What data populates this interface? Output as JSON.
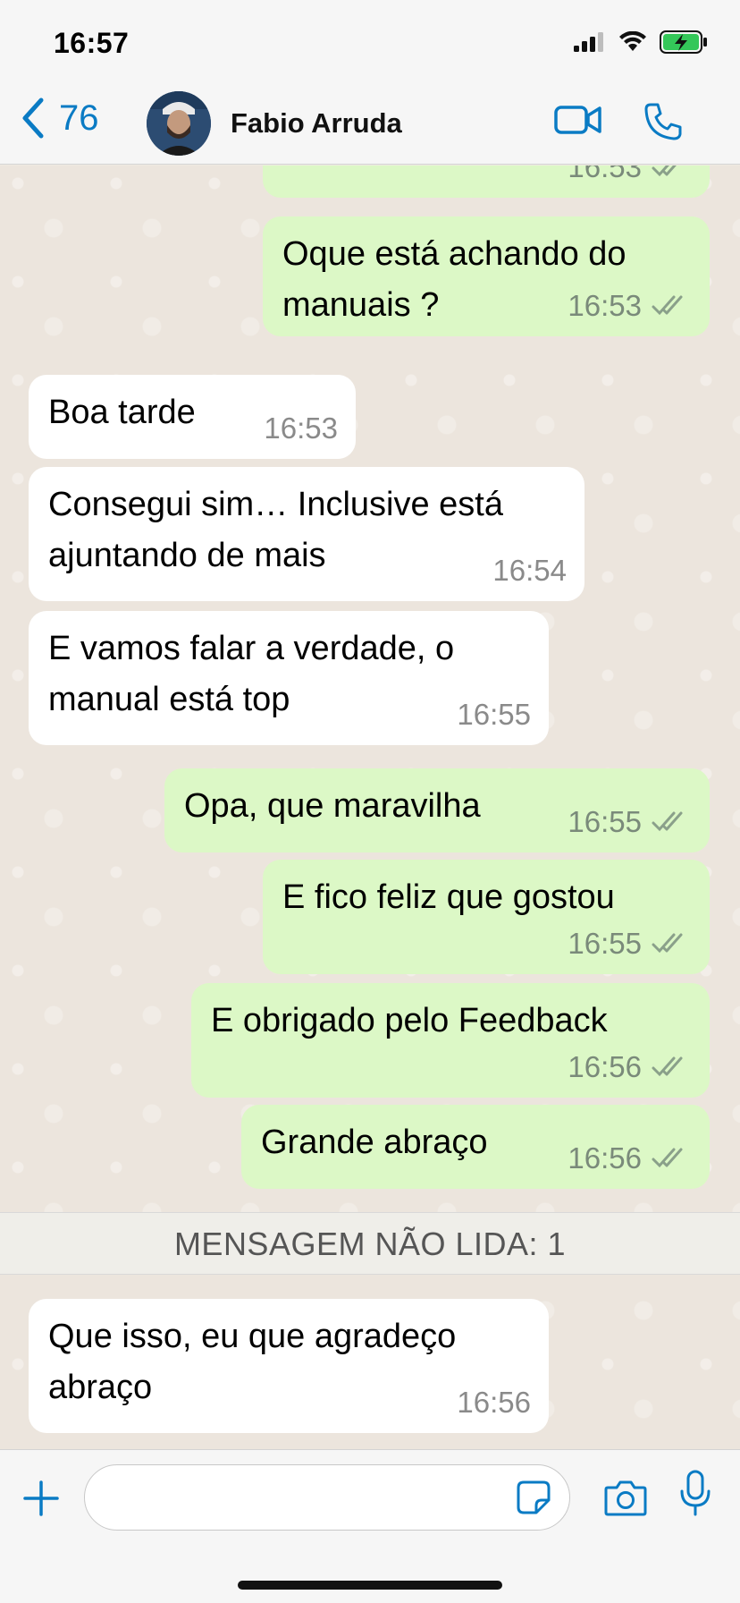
{
  "status_bar": {
    "time": "16:57"
  },
  "header": {
    "back_count": "76",
    "contact_name": "Fabio Arruda"
  },
  "messages": [
    {
      "dir": "out",
      "text": "",
      "time": "16:53",
      "read": true
    },
    {
      "dir": "out",
      "text": "Oque está achando do manuais ?",
      "time": "16:53",
      "read": true
    },
    {
      "dir": "in",
      "text": "Boa tarde",
      "time": "16:53"
    },
    {
      "dir": "in",
      "text": "Consegui sim… Inclusive está ajuntando de mais",
      "time": "16:54"
    },
    {
      "dir": "in",
      "text": "E vamos falar a verdade, o manual está top",
      "time": "16:55"
    },
    {
      "dir": "out",
      "text": "Opa, que maravilha",
      "time": "16:55",
      "read": true
    },
    {
      "dir": "out",
      "text": "E fico feliz que gostou",
      "time": "16:55",
      "read": true
    },
    {
      "dir": "out",
      "text": "E obrigado pelo Feedback",
      "time": "16:56",
      "read": true
    },
    {
      "dir": "out",
      "text": "Grande abraço",
      "time": "16:56",
      "read": true
    },
    {
      "dir": "in",
      "text": "Que isso, eu que agradeço abraço",
      "time": "16:56"
    }
  ],
  "unread_banner": "MENSAGEM NÃO LIDA: 1",
  "input": {
    "value": "",
    "placeholder": ""
  },
  "colors": {
    "accent": "#0a7bc4",
    "outgoing_bubble": "#dcf8c6",
    "incoming_bubble": "#ffffff",
    "read_ticks": "#8aa08a"
  }
}
